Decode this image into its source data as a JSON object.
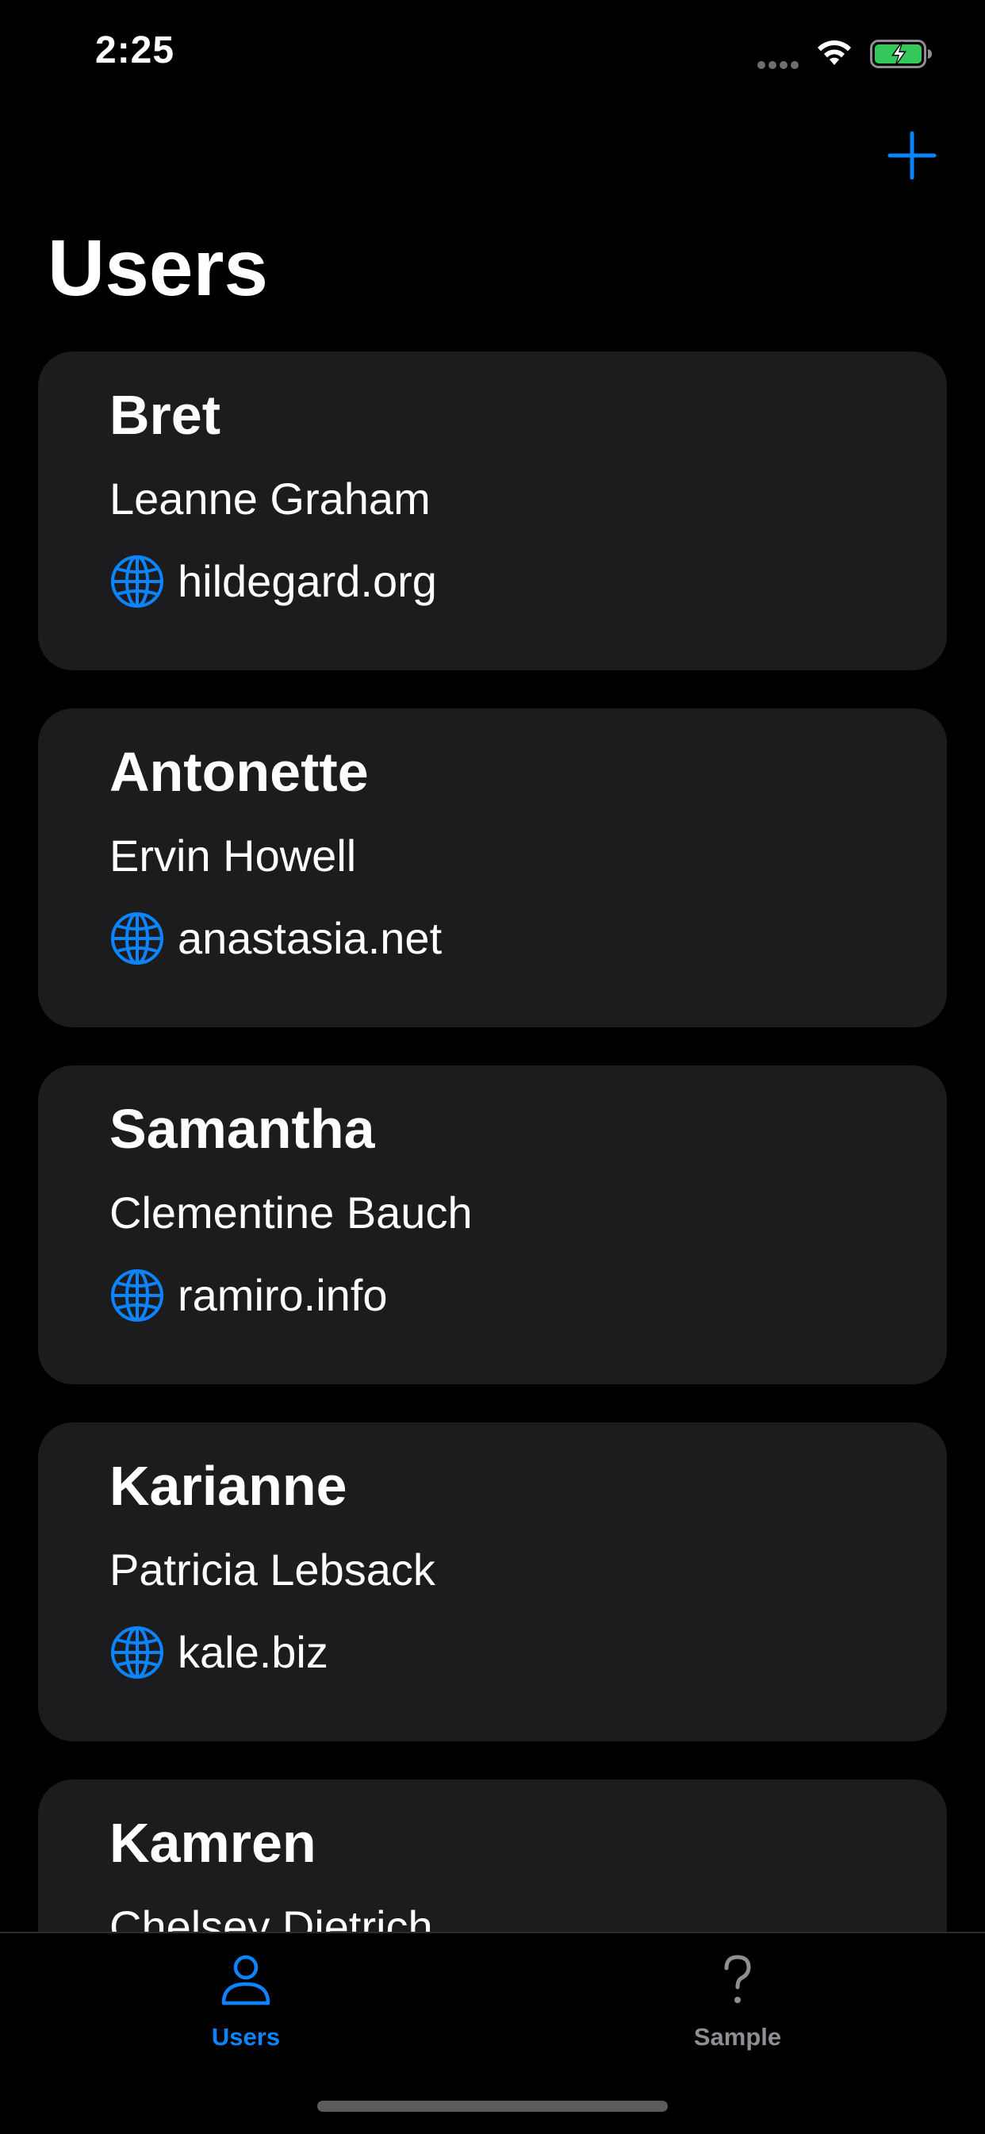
{
  "status_bar": {
    "time": "2:25"
  },
  "nav": {
    "title": "Users",
    "add_icon": "plus-icon"
  },
  "colors": {
    "accent": "#0a84ff",
    "card_background": "#1c1c1e",
    "background": "#000000",
    "inactive": "#8e8e93",
    "battery_green": "#34c759"
  },
  "users": [
    {
      "username": "Bret",
      "name": "Leanne Graham",
      "website": "hildegard.org"
    },
    {
      "username": "Antonette",
      "name": "Ervin Howell",
      "website": "anastasia.net"
    },
    {
      "username": "Samantha",
      "name": "Clementine Bauch",
      "website": "ramiro.info"
    },
    {
      "username": "Karianne",
      "name": "Patricia Lebsack",
      "website": "kale.biz"
    },
    {
      "username": "Kamren",
      "name": "Chelsey Dietrich"
    }
  ],
  "tabs": [
    {
      "label": "Users",
      "icon": "person-icon",
      "active": true
    },
    {
      "label": "Sample",
      "icon": "question-mark-icon",
      "active": false
    }
  ]
}
